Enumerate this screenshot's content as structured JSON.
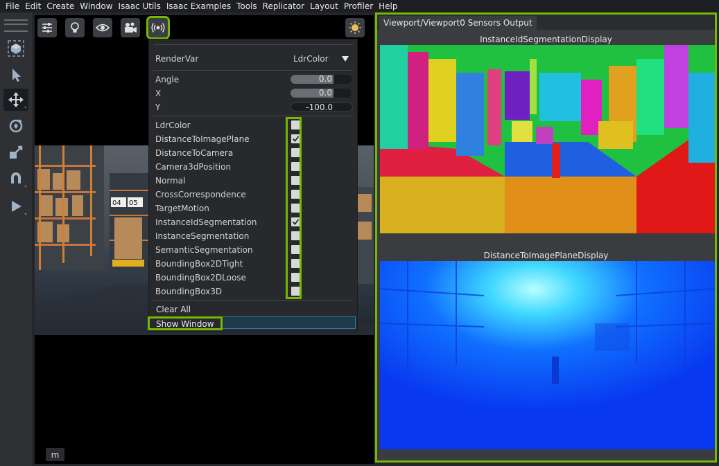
{
  "menubar": {
    "items": [
      "File",
      "Edit",
      "Create",
      "Window",
      "Isaac Utils",
      "Isaac Examples",
      "Tools",
      "Replicator",
      "Layout",
      "Profiler",
      "Help"
    ]
  },
  "left_toolbar": {
    "tools": [
      "box-select-icon",
      "select-arrow-icon",
      "move-icon",
      "rotate-icon",
      "scale-icon",
      "snap-magnet-icon",
      "play-icon"
    ],
    "active_tool": "move-icon"
  },
  "viewport": {
    "top_buttons": [
      "settings-sliders-icon",
      "lightbulb-icon",
      "eye-icon",
      "camera-icon",
      "sensor-broadcast-icon"
    ],
    "highlighted_button": "sensor-broadcast-icon",
    "right_button": "sun-icon",
    "bottom_label": "m"
  },
  "sensor_panel": {
    "rendervar_label": "RenderVar",
    "rendervar_value": "LdrColor",
    "params": [
      {
        "label": "Angle",
        "value": "0.0",
        "fill": 0.7
      },
      {
        "label": "X",
        "value": "0.0",
        "fill": 0.7
      },
      {
        "label": "Y",
        "value": "-100.0",
        "fill": 0.0
      }
    ],
    "render_vars": [
      {
        "label": "LdrColor",
        "checked": false
      },
      {
        "label": "DistanceToImagePlane",
        "checked": true
      },
      {
        "label": "DistanceToCamera",
        "checked": false
      },
      {
        "label": "Camera3dPosition",
        "checked": false
      },
      {
        "label": "Normal",
        "checked": false
      },
      {
        "label": "CrossCorrespondence",
        "checked": false
      },
      {
        "label": "TargetMotion",
        "checked": false
      },
      {
        "label": "InstanceIdSegmentation",
        "checked": true
      },
      {
        "label": "InstanceSegmentation",
        "checked": false
      },
      {
        "label": "SemanticSegmentation",
        "checked": false
      },
      {
        "label": "BoundingBox2DTight",
        "checked": false
      },
      {
        "label": "BoundingBox2DLoose",
        "checked": false
      },
      {
        "label": "BoundingBox3D",
        "checked": false
      }
    ],
    "clear_all": "Clear All",
    "show_window": "Show Window"
  },
  "sensors_window": {
    "tab_title": "Viewport/Viewport0 Sensors Output",
    "display1_caption": "InstanceIdSegmentationDisplay",
    "display2_caption": "DistanceToImagePlaneDisplay"
  },
  "scene_labels": {
    "rack_a": "04",
    "rack_b": "05"
  },
  "colors": {
    "highlight": "#76b900",
    "panel_bg": "#27292d"
  }
}
